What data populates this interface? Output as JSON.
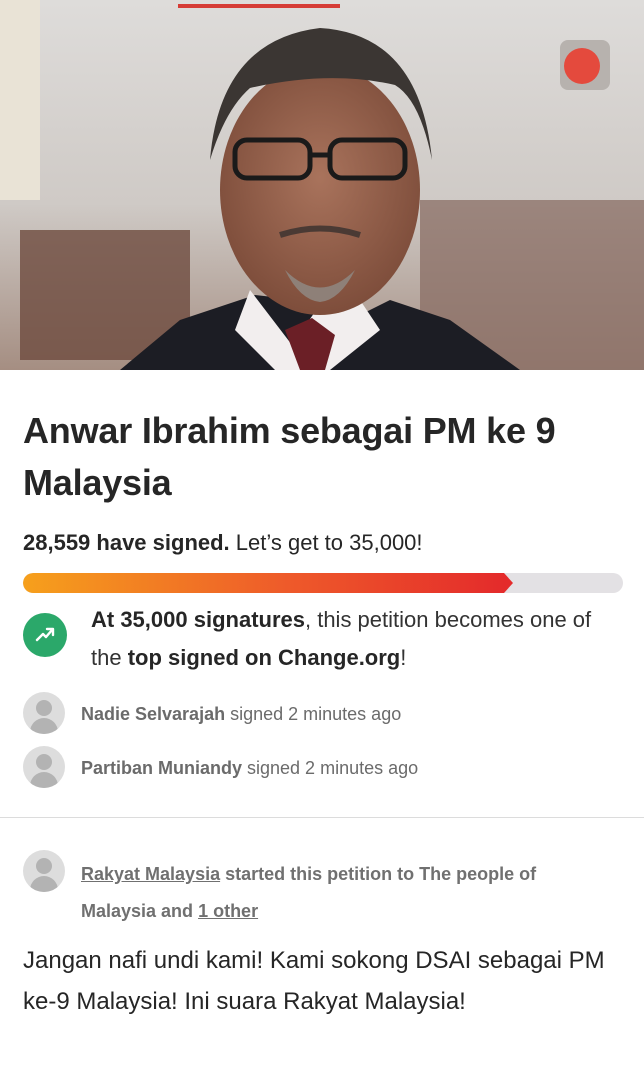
{
  "petition": {
    "title": "Anwar Ibrahim sebagai PM ke 9 Malaysia",
    "signed_count_label": "28,559 have signed.",
    "goal_label": " Let’s get to 35,000!",
    "progress_fraction": 0.816
  },
  "milestone": {
    "bold1": "At 35,000 signatures",
    "text1": ", this petition becomes one of the ",
    "bold2": "top signed on Change.org",
    "text2": "!",
    "icon": "trending-up-icon",
    "color": "#2ba86a"
  },
  "recent_signers": [
    {
      "name": "Nadie Selvarajah",
      "action": " signed 2 minutes ago"
    },
    {
      "name": "Partiban Muniandy",
      "action": " signed 2 minutes ago"
    }
  ],
  "starter": {
    "name": "Rakyat Malaysia",
    "text": " started this petition to The people of Malaysia and ",
    "others": "1 other"
  },
  "description": "Jangan nafi undi kami! Kami sokong DSAI sebagai PM ke-9 Malaysia! Ini suara Rakyat Malaysia!",
  "colors": {
    "accent_red": "#d63c36",
    "progress_start": "#f6a01c",
    "progress_end": "#e42b2b",
    "milestone_green": "#2ba86a"
  }
}
